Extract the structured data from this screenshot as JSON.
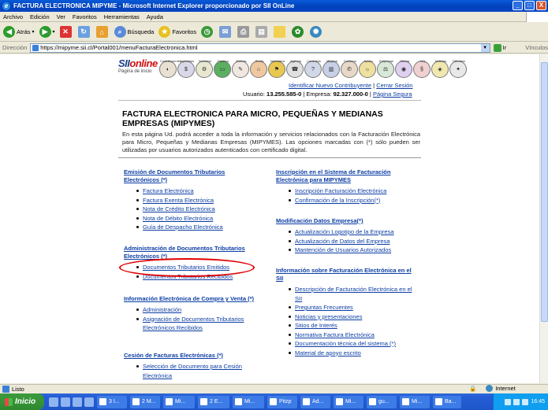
{
  "window": {
    "title": "FACTURA ELECTRONICA MIPYME - Microsoft Internet Explorer proporcionado por SII OnLine",
    "buttons": [
      "_",
      "□",
      "X"
    ]
  },
  "menu": [
    "Archivo",
    "Edición",
    "Ver",
    "Favoritos",
    "Herramientas",
    "Ayuda"
  ],
  "toolbar": {
    "back": "Atrás",
    "search": "Búsqueda",
    "favorites": "Favoritos"
  },
  "address": {
    "label": "Dirección",
    "url": "https://mipyme.sii.cl/Portal001/menuFacturaElectronica.html",
    "go": "Ir",
    "links": "Vínculos"
  },
  "page": {
    "logo_text": "SII",
    "logo_sub": "Página de inicio",
    "menu_icons": [
      "Contribuyentes",
      "Impuestos",
      "Servicios",
      "Factura",
      "Boletas",
      "Renta",
      "Normativa",
      "Agenda",
      "Consultas",
      "Mipyme",
      "Contacto",
      "Ayuda",
      "Empresas",
      "Oficina",
      "Ley",
      "Noticias",
      "Tributario"
    ],
    "register_link": "Identificar Nuevo Contribuyente",
    "logout_link": "Cerrar Sesión",
    "user_label": "Usuario:",
    "user_value": "13.255.585-0",
    "company_label": "Empresa:",
    "company_value": "92.327.000-0",
    "secure_link": "Página Segura",
    "title": "FACTURA ELECTRONICA PARA MICRO, PEQUEÑAS Y MEDIANAS EMPRESAS (MIPYMES)",
    "intro": "En esta página Ud. podrá acceder a toda la información y servicios relacionados con la Facturación Electrónica para Micro, Pequeñas y Medianas Empresas (MIPYMES). Las opciones marcadas con (*) sólo pueden ser utilizadas por usuarios autorizados autenticados con certificado digital.",
    "left_sections": [
      {
        "title": "Emisión de Documentos Tributarios Electrónicos (*)",
        "items": [
          "Factura Electrónica",
          "Factura Exenta Electrónica",
          "Nota de Crédito Electrónica",
          "Nota de Débito Electrónica",
          "Guía de Despacho Electrónica"
        ]
      },
      {
        "title": "Administración de Documentos Tributarios Electrónicos (*)",
        "items": [
          "Documentos Tributarios Emitidos",
          "Documentos Tributarios Recibidos"
        ]
      },
      {
        "title": "Información Electrónica de Compra y Venta (*)",
        "items": [
          "Administración",
          "Asignación de Documentos Tributarios Electrónicos Recibidos"
        ]
      },
      {
        "title": "Cesión de Facturas Electrónicas (*)",
        "items": [
          "Selección de Documento para Cesión Electrónica"
        ]
      }
    ],
    "right_sections": [
      {
        "title": "Inscripción en el Sistema de Facturación Electrónica para MIPYMES",
        "items": [
          "Inscripción Facturación Electrónica",
          "Confirmación de la Inscripción(*)"
        ]
      },
      {
        "title": "Modificación Datos Empresa(*)",
        "items": [
          "Actualización Logotipo de la Empresa",
          "Actualización de Datos del Empresa",
          "Mantención de Usuarios Autorizados"
        ]
      },
      {
        "title": "Información sobre Facturación Electrónica en el SII",
        "items": [
          "Descripción de Facturación Electrónica en el SII",
          "Preguntas Frecuentes",
          "Noticias y presentaciones",
          "Sitios de Interés",
          "Normativa Factura Electrónica",
          "Documentación técnica del sistema (*)",
          "Material de apoyo escrito"
        ]
      }
    ]
  },
  "status": {
    "text": "Listo",
    "zone": "Internet"
  },
  "taskbar": {
    "start": "Inicio",
    "tasks": [
      "3 I...",
      "2 M...",
      "Mi...",
      "2 E...",
      "Mi...",
      "Pitzp",
      "Ad...",
      "Mi...",
      "gu...",
      "Mi...",
      "Ba..."
    ],
    "clock": "16:45"
  }
}
